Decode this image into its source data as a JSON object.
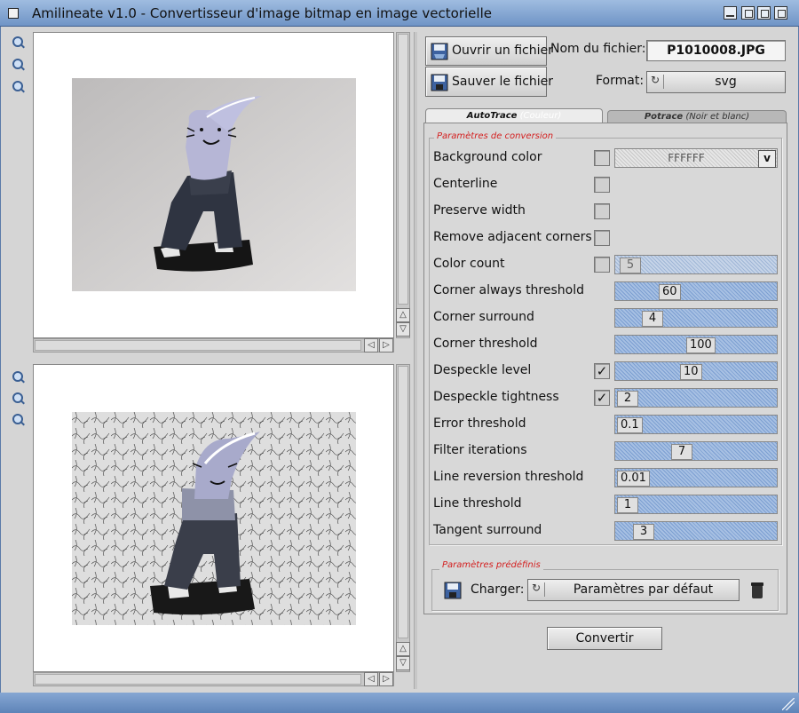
{
  "window": {
    "title": "Amilineate v1.0 - Convertisseur d'image bitmap en image vectorielle"
  },
  "toolbar": {
    "open_label": "Ouvrir un fichier",
    "save_label": "Sauver le fichier",
    "filename_label": "Nom du fichier:",
    "filename_value": "P1010008.JPG",
    "format_label": "Format:",
    "format_value": "svg"
  },
  "tabs": [
    {
      "label": "AutoTrace",
      "sublabel": "(Couleur)",
      "active": true
    },
    {
      "label": "Potrace",
      "sublabel": "(Noir et blanc)",
      "active": false
    }
  ],
  "conversion": {
    "group_title": "Paramètres de conversion",
    "background_color_value": "FFFFFF",
    "background_color_popup": "v",
    "params": [
      {
        "label": "Background color",
        "checkbox": true,
        "checked": false
      },
      {
        "label": "Centerline",
        "checkbox": true,
        "checked": false
      },
      {
        "label": "Preserve width",
        "checkbox": true,
        "checked": false
      },
      {
        "label": "Remove adjacent corners",
        "checkbox": true,
        "checked": false
      },
      {
        "label": "Color count",
        "checkbox": true,
        "checked": false,
        "value": "5",
        "min": 0,
        "max": 256,
        "level": 0.02
      },
      {
        "label": "Corner always threshold",
        "value": "60",
        "min": 0,
        "max": 180,
        "level": 0.33
      },
      {
        "label": "Corner surround",
        "value": "4",
        "min": 0,
        "max": 20,
        "level": 0.2
      },
      {
        "label": "Corner threshold",
        "value": "100",
        "min": 0,
        "max": 180,
        "level": 0.55
      },
      {
        "label": "Despeckle level",
        "checkbox": true,
        "checked": true,
        "check_glyph": "✓",
        "value": "10",
        "min": 0,
        "max": 20,
        "level": 0.5
      },
      {
        "label": "Despeckle tightness",
        "checkbox": true,
        "checked": true,
        "check_glyph": "✓",
        "value": "2",
        "min": 0,
        "max": 8,
        "level": 0.0
      },
      {
        "label": "Error threshold",
        "value": "0.1",
        "min": 0.1,
        "max": 10,
        "level": 0.0
      },
      {
        "label": "Filter iterations",
        "value": "7",
        "min": 0,
        "max": 20,
        "level": 0.43
      },
      {
        "label": "Line reversion threshold",
        "value": "0.01",
        "min": 0.01,
        "max": 1,
        "level": 0.0
      },
      {
        "label": "Line threshold",
        "value": "1",
        "min": 1,
        "max": 20,
        "level": 0.0
      },
      {
        "label": "Tangent surround",
        "value": "3",
        "min": 0,
        "max": 20,
        "level": 0.13
      }
    ]
  },
  "presets": {
    "group_title": "Paramètres prédéfinis",
    "load_label": "Charger:",
    "preset_value": "Paramètres par défaut"
  },
  "convert_label": "Convertir",
  "icons": {
    "zoom_in": "zoom-in-icon",
    "zoom_reset": "zoom-reset-icon",
    "zoom_out": "zoom-out-icon",
    "scroll_up": "△",
    "scroll_down": "▽",
    "scroll_left": "◁",
    "scroll_right": "▷"
  },
  "colors": {
    "accent": "#6b8fbf",
    "group_title": "#d42020",
    "window_bg": "#d5d5d5"
  }
}
